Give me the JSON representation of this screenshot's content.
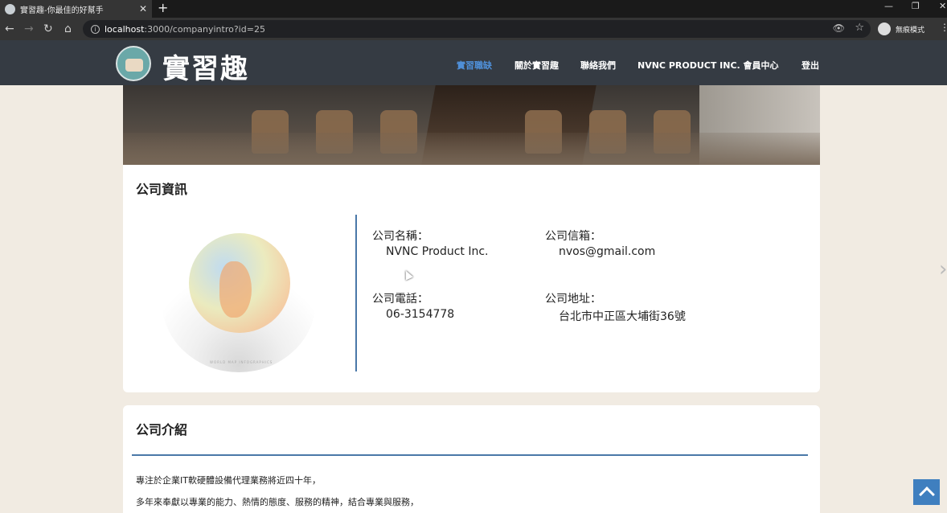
{
  "browser": {
    "tab_title": "實習趣-你最佳的好幫手",
    "tab_close": "✕",
    "new_tab": "+",
    "url_host": "localhost",
    "url_rest": ":3000/companyintro?id=25",
    "profile_label": "無痕模式",
    "win_min": "—",
    "win_restore": "❐",
    "win_close": "✕"
  },
  "site": {
    "logo_text": "實習趣",
    "nav": [
      {
        "label": "實習職缺"
      },
      {
        "label": "關於實習趣"
      },
      {
        "label": "聯絡我們"
      },
      {
        "label": "NVNC PRODUCT INC. 會員中心"
      },
      {
        "label": "登出"
      }
    ],
    "active_nav": "實習職缺"
  },
  "company_info": {
    "title": "公司資訊",
    "globe_caption": "WORLD MAP INFOGRAPHICS",
    "fields": {
      "name_label": "公司名稱：",
      "name_value": "NVNC Product Inc.",
      "email_label": "公司信箱：",
      "email_value": "nvos@gmail.com",
      "phone_label": "公司電話：",
      "phone_value": "06-3154778",
      "address_label": "公司地址：",
      "address_value": "台北市中正區大埔街36號"
    }
  },
  "company_intro": {
    "title": "公司介紹",
    "lines": [
      "專注於企業IT軟硬體設備代理業務將近四十年，",
      "多年來奉獻以專業的能力、熱情的態度、服務的精神，結合專業與服務，"
    ]
  },
  "colors": {
    "accent": "#4a78a8",
    "nav_active": "#4f8fd8",
    "navbar_bg": "#353b43",
    "page_bg": "#f1ebe2"
  }
}
